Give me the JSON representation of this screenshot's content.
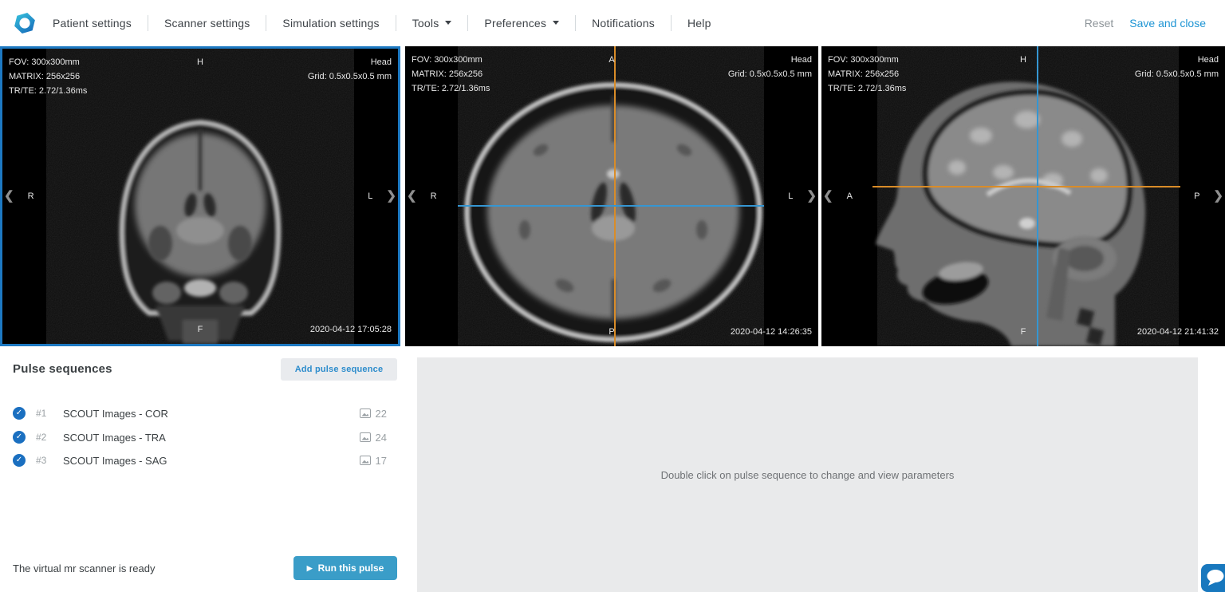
{
  "navbar": {
    "items": [
      {
        "label": "Patient settings"
      },
      {
        "label": "Scanner settings"
      },
      {
        "label": "Simulation settings"
      },
      {
        "label": "Tools",
        "dropdown": true
      },
      {
        "label": "Preferences",
        "dropdown": true
      },
      {
        "label": "Notifications"
      },
      {
        "label": "Help"
      }
    ],
    "reset_label": "Reset",
    "save_label": "Save and close"
  },
  "viewports": [
    {
      "name": "coronal",
      "selected": true,
      "fov": "FOV: 300x300mm",
      "matrix": "MATRIX: 256x256",
      "trte": "TR/TE: 2.72/1.36ms",
      "top_label": "H",
      "region": "Head",
      "grid": "Grid: 0.5x0.5x0.5 mm",
      "left_label": "R",
      "right_label": "L",
      "bottom_label": "F",
      "timestamp": "2020-04-12 17:05:28"
    },
    {
      "name": "axial",
      "selected": false,
      "fov": "FOV: 300x300mm",
      "matrix": "MATRIX: 256x256",
      "trte": "TR/TE: 2.72/1.36ms",
      "top_label": "A",
      "region": "Head",
      "grid": "Grid: 0.5x0.5x0.5 mm",
      "left_label": "R",
      "right_label": "L",
      "bottom_label": "P",
      "timestamp": "2020-04-12 14:26:35"
    },
    {
      "name": "sagittal",
      "selected": false,
      "fov": "FOV: 300x300mm",
      "matrix": "MATRIX: 256x256",
      "trte": "TR/TE: 2.72/1.36ms",
      "top_label": "H",
      "region": "Head",
      "grid": "Grid: 0.5x0.5x0.5 mm",
      "left_label": "A",
      "right_label": "P",
      "bottom_label": "F",
      "timestamp": "2020-04-12 21:41:32"
    }
  ],
  "pulse_sequences": {
    "title": "Pulse sequences",
    "add_button_label": "Add pulse sequence",
    "items": [
      {
        "number": "#1",
        "name": "SCOUT Images - COR",
        "image_count": "22"
      },
      {
        "number": "#2",
        "name": "SCOUT Images - TRA",
        "image_count": "24"
      },
      {
        "number": "#3",
        "name": "SCOUT Images - SAG",
        "image_count": "17"
      }
    ],
    "status_text": "The virtual mr scanner is ready",
    "run_button_label": "Run this pulse"
  },
  "parameters_panel": {
    "hint": "Double click on pulse sequence to change and view parameters"
  },
  "icons": {
    "chevron_left": "❮",
    "chevron_right": "❯",
    "check": "✓",
    "run_play": "▶"
  },
  "colors": {
    "accent_blue": "#1e95d4",
    "selected_viewport_border": "#1d79c2",
    "crosshair_orange": "#d98c28",
    "crosshair_blue": "#3596d2",
    "run_button": "#3a9dc8",
    "check_circle": "#1a6fc0",
    "chat_button": "#1878be"
  }
}
